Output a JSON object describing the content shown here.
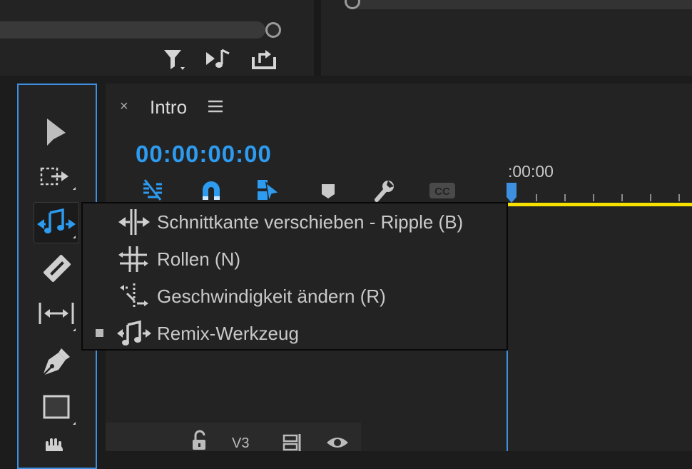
{
  "sequence": {
    "title": "Intro",
    "close_symbol": "×",
    "timecode": "00:00:00:00",
    "ruler_label": ":00:00"
  },
  "track_header": {
    "track_label": "V3"
  },
  "tool_menu": {
    "items": [
      {
        "label": "Schnittkante verschieben - Ripple (B)",
        "icon": "ripple-edit-icon",
        "selected": false
      },
      {
        "label": "Rollen (N)",
        "icon": "rolling-edit-icon",
        "selected": false
      },
      {
        "label": "Geschwindigkeit ändern (R)",
        "icon": "rate-stretch-icon",
        "selected": false
      },
      {
        "label": "Remix-Werkzeug",
        "icon": "remix-tool-icon",
        "selected": true
      }
    ]
  },
  "tools": [
    "selection-tool-icon",
    "track-select-icon",
    "remix-tool-icon",
    "razor-tool-icon",
    "slip-tool-icon",
    "pen-tool-icon",
    "rectangle-tool-icon",
    "hand-tool-icon"
  ],
  "colors": {
    "accent": "#2d9bf0",
    "playhead": "#3f8fe0",
    "work_area": "#f5e000",
    "menu_bg": "#232323"
  }
}
